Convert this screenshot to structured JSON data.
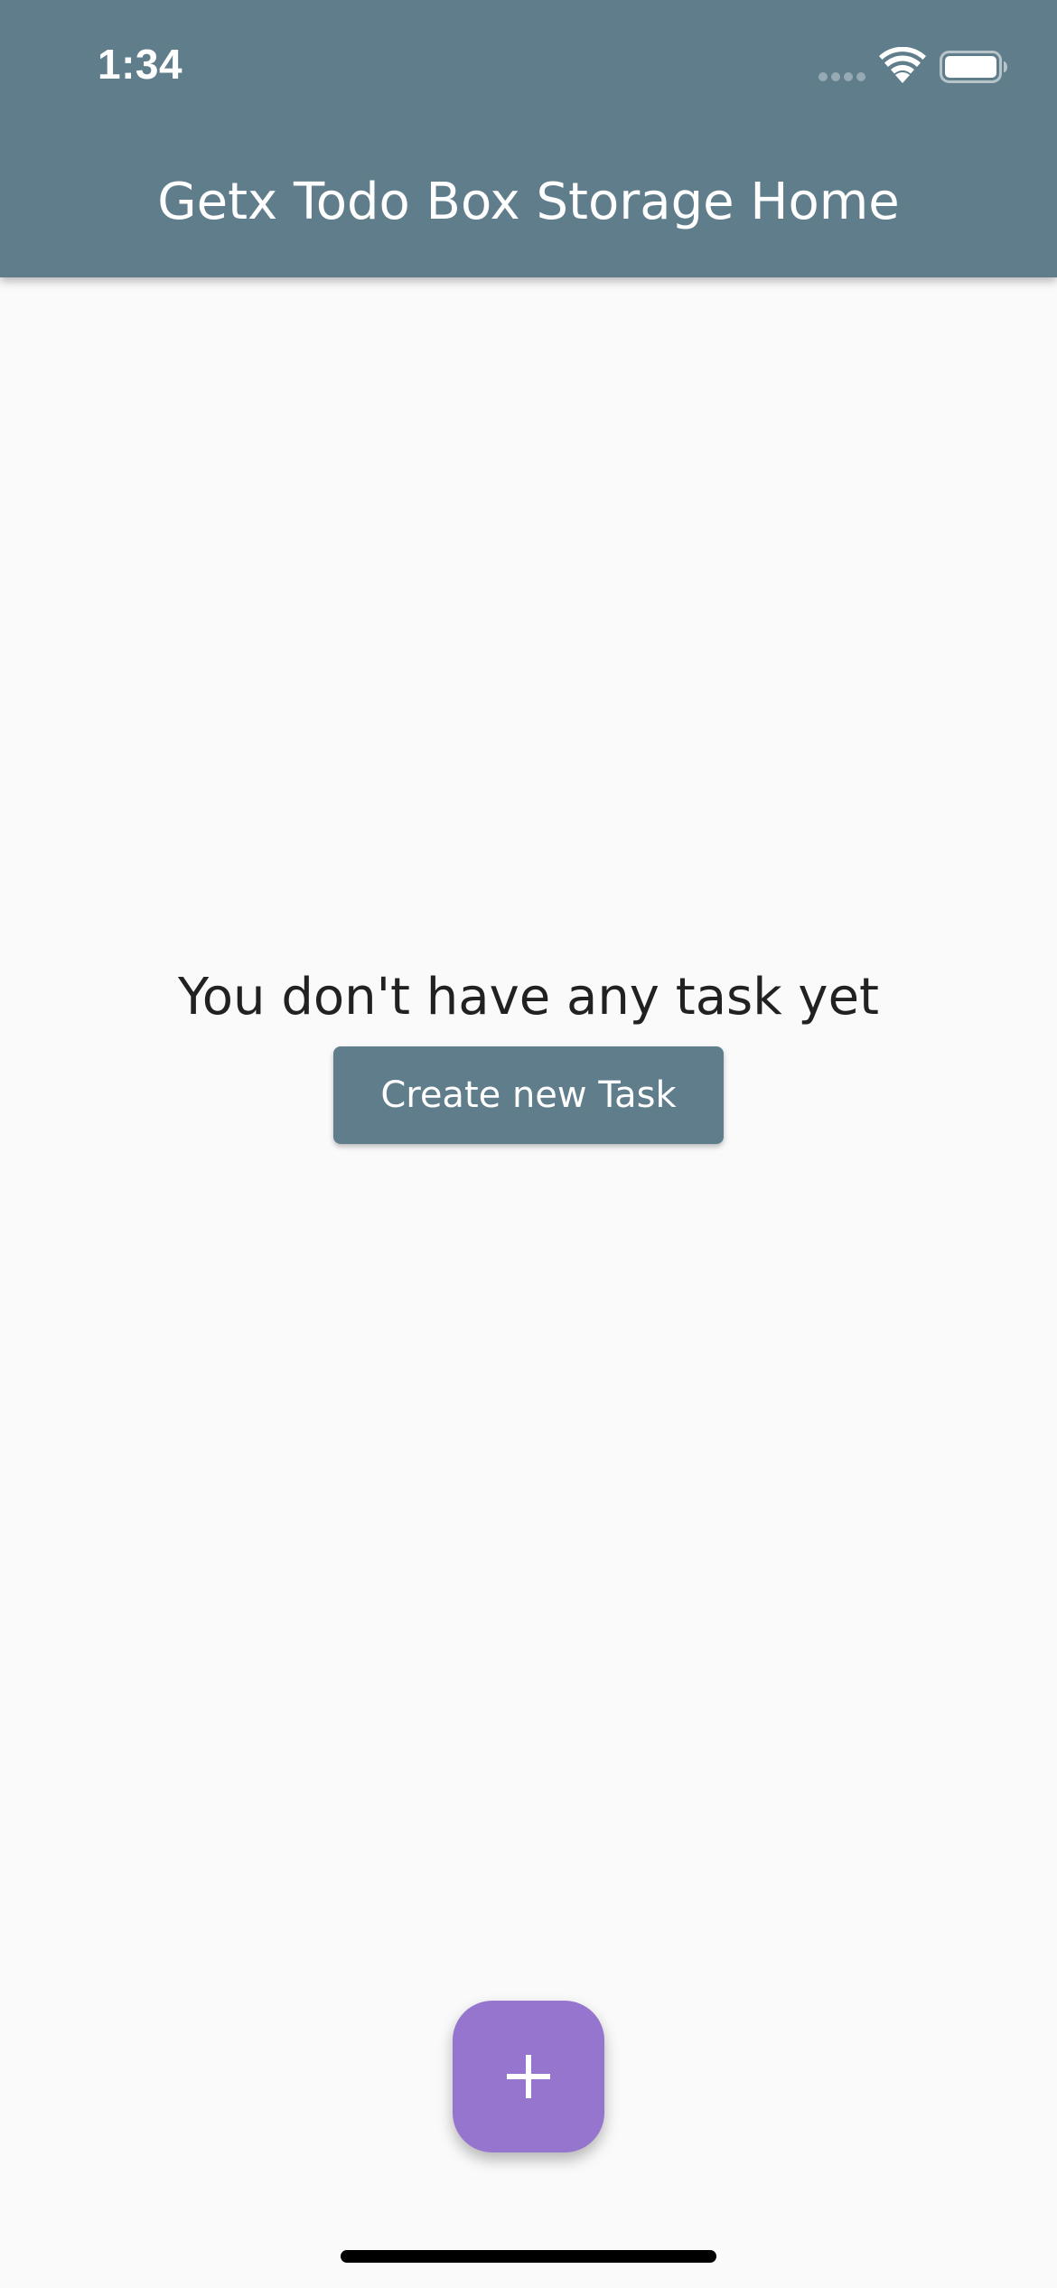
{
  "status_bar": {
    "time": "1:34",
    "wifi_icon": "wifi-icon",
    "battery_icon": "battery-icon",
    "signal_icon": "signal-dots-icon"
  },
  "app_bar": {
    "title": "Getx Todo Box Storage Home",
    "color": "#607d8b"
  },
  "main": {
    "empty_message": "You don't have any task yet",
    "create_button_label": "Create new Task"
  },
  "fab": {
    "icon": "plus-icon",
    "color": "#9575cd"
  }
}
